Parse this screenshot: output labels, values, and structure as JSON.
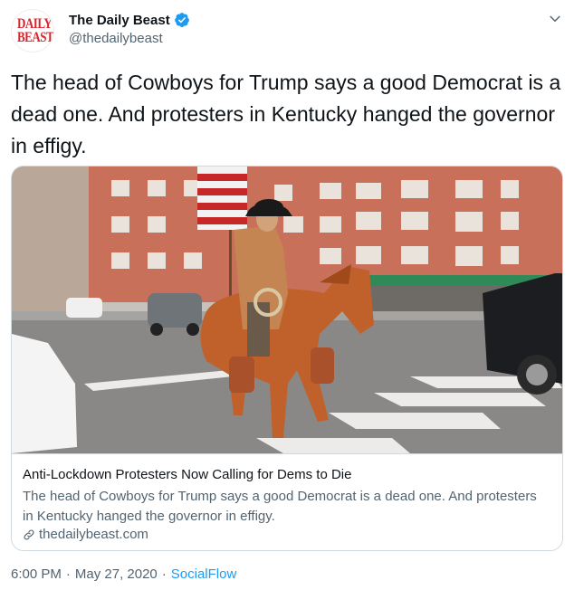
{
  "account": {
    "display_name": "The Daily Beast",
    "handle": "@thedailybeast",
    "avatar_line1": "DAILY",
    "avatar_line2": "BEAST",
    "verified": true
  },
  "tweet": {
    "text": "The head of Cowboys for Trump says a good Democrat is a dead one. And protesters in Kentucky hanged the governor in effigy."
  },
  "card": {
    "title": "Anti-Lockdown Protesters Now Calling for Dems to Die",
    "description": "The head of Cowboys for Trump says a good Democrat is a dead one. And protesters in Kentucky hanged the governor in effigy.",
    "domain": "thedailybeast.com",
    "image_icon": "photo-cowboy-on-horse"
  },
  "meta": {
    "time": "6:00 PM",
    "date": "May 27, 2020",
    "separator": "·",
    "source": "SocialFlow"
  },
  "colors": {
    "text": "#0f1419",
    "secondary": "#536471",
    "accent": "#1d9bf0",
    "brand": "#d8232a"
  }
}
